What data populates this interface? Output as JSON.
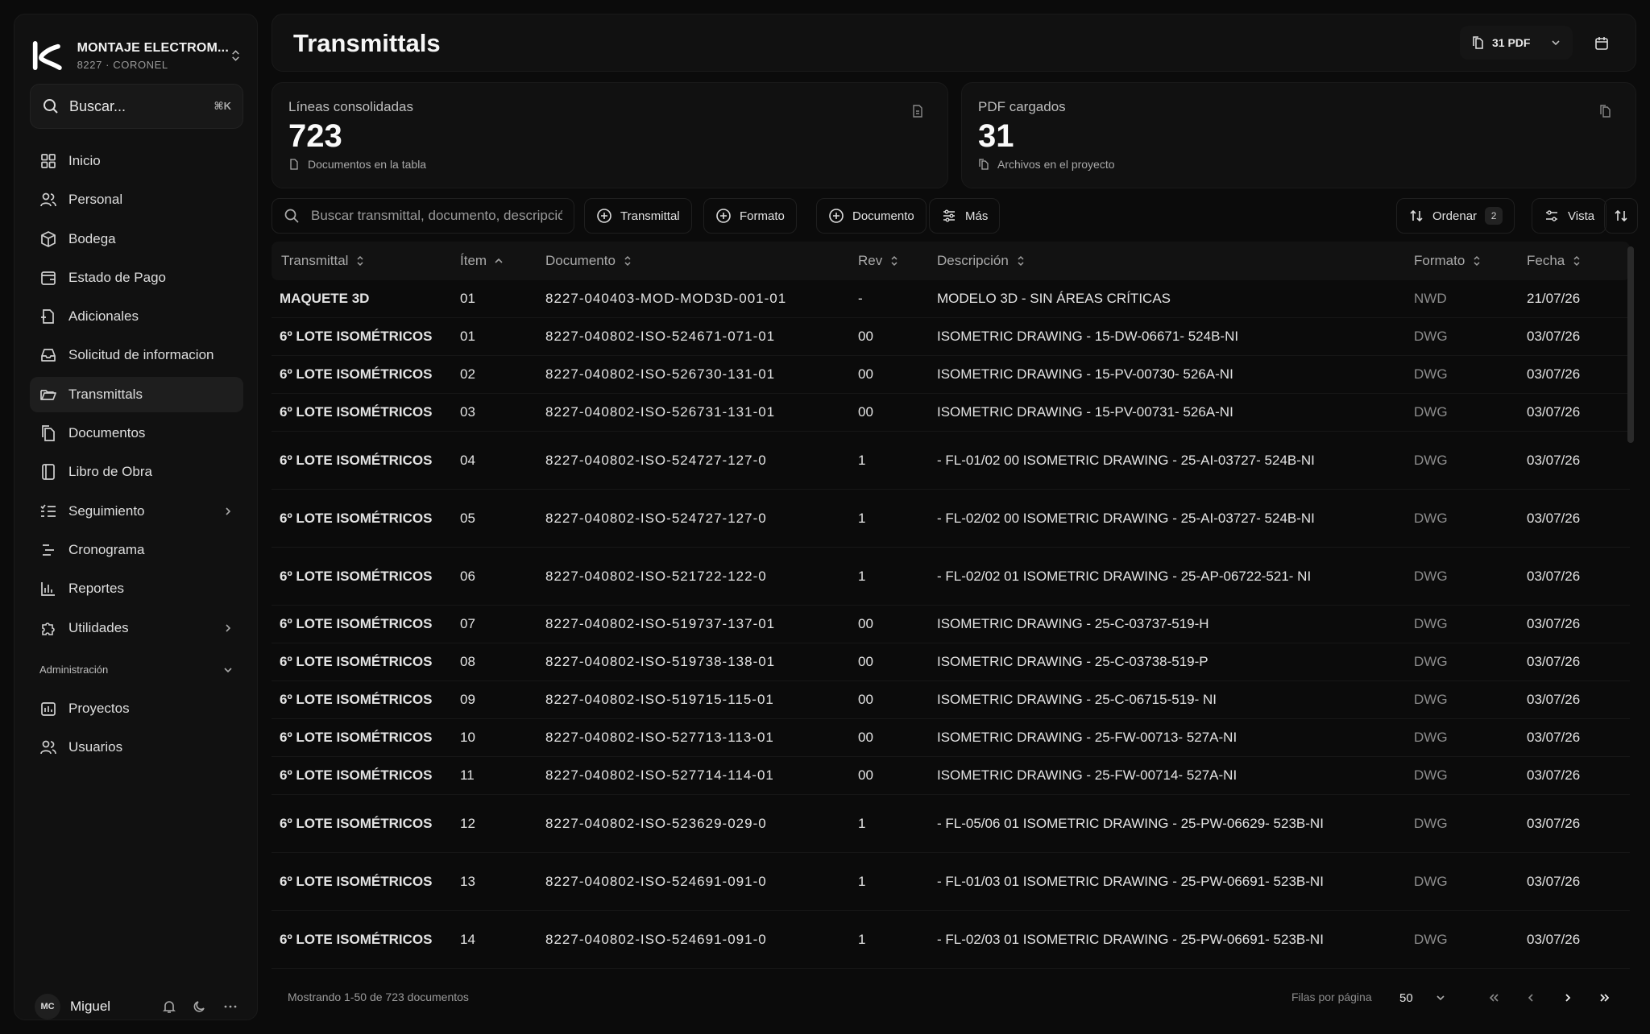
{
  "sidebar": {
    "company": "MONTAJE ELECTROM...",
    "company_sub": "8227 · CORONEL",
    "search_label": "Buscar...",
    "search_shortcut": "⌘K",
    "items": [
      {
        "label": "Inicio"
      },
      {
        "label": "Personal"
      },
      {
        "label": "Bodega"
      },
      {
        "label": "Estado de Pago"
      },
      {
        "label": "Adicionales"
      },
      {
        "label": "Solicitud de informacion"
      },
      {
        "label": "Transmittals"
      },
      {
        "label": "Documentos"
      },
      {
        "label": "Libro de Obra"
      },
      {
        "label": "Seguimiento"
      },
      {
        "label": "Cronograma"
      },
      {
        "label": "Reportes"
      },
      {
        "label": "Utilidades"
      }
    ],
    "section_label": "Administración",
    "admin_items": [
      {
        "label": "Proyectos"
      },
      {
        "label": "Usuarios"
      }
    ],
    "user": {
      "initials": "MC",
      "name": "Miguel"
    }
  },
  "header": {
    "title": "Transmittals",
    "pdf_button": "31 PDF"
  },
  "stats": [
    {
      "label": "Líneas consolidadas",
      "value": "723",
      "sub": "Documentos en la tabla"
    },
    {
      "label": "PDF cargados",
      "value": "31",
      "sub": "Archivos en el proyecto"
    }
  ],
  "toolbar": {
    "search_placeholder": "Buscar transmittal, documento, descripción...",
    "filters": [
      "Transmittal",
      "Formato",
      "Documento",
      "Más"
    ],
    "sort_label": "Ordenar",
    "sort_count": "2",
    "view_label": "Vista"
  },
  "table": {
    "columns": [
      "Transmittal",
      "Ítem",
      "Documento",
      "Rev",
      "Descripción",
      "Formato",
      "Fecha"
    ],
    "rows": [
      {
        "transmittal": "MAQUETE 3D",
        "item": "01",
        "documento": "8227-040403-MOD-MOD3D-001-01",
        "rev": "-",
        "descripcion": "MODELO 3D - SIN ÁREAS CRÍTICAS",
        "formato": "NWD",
        "fecha": "21/07/26"
      },
      {
        "transmittal": "6º LOTE ISOMÉTRICOS",
        "item": "01",
        "documento": "8227-040802-ISO-524671-071-01",
        "rev": "00",
        "descripcion": "ISOMETRIC DRAWING - 15-DW-06671- 524B-NI",
        "formato": "DWG",
        "fecha": "03/07/26"
      },
      {
        "transmittal": "6º LOTE ISOMÉTRICOS",
        "item": "02",
        "documento": "8227-040802-ISO-526730-131-01",
        "rev": "00",
        "descripcion": "ISOMETRIC DRAWING - 15-PV-00730- 526A-NI",
        "formato": "DWG",
        "fecha": "03/07/26"
      },
      {
        "transmittal": "6º LOTE ISOMÉTRICOS",
        "item": "03",
        "documento": "8227-040802-ISO-526731-131-01",
        "rev": "00",
        "descripcion": "ISOMETRIC DRAWING - 15-PV-00731- 526A-NI",
        "formato": "DWG",
        "fecha": "03/07/26"
      },
      {
        "transmittal": "6º LOTE ISOMÉTRICOS",
        "item": "04",
        "documento": "8227-040802-ISO-524727-127-0",
        "rev": "1",
        "descripcion": "- FL-01/02 00 ISOMETRIC DRAWING - 25-AI-03727- 524B-NI",
        "formato": "DWG",
        "fecha": "03/07/26"
      },
      {
        "transmittal": "6º LOTE ISOMÉTRICOS",
        "item": "05",
        "documento": "8227-040802-ISO-524727-127-0",
        "rev": "1",
        "descripcion": "- FL-02/02 00 ISOMETRIC DRAWING - 25-AI-03727- 524B-NI",
        "formato": "DWG",
        "fecha": "03/07/26"
      },
      {
        "transmittal": "6º LOTE ISOMÉTRICOS",
        "item": "06",
        "documento": "8227-040802-ISO-521722-122-0",
        "rev": "1",
        "descripcion": "- FL-02/02 01 ISOMETRIC DRAWING - 25-AP-06722-521- NI",
        "formato": "DWG",
        "fecha": "03/07/26"
      },
      {
        "transmittal": "6º LOTE ISOMÉTRICOS",
        "item": "07",
        "documento": "8227-040802-ISO-519737-137-01",
        "rev": "00",
        "descripcion": "ISOMETRIC DRAWING - 25-C-03737-519-H",
        "formato": "DWG",
        "fecha": "03/07/26"
      },
      {
        "transmittal": "6º LOTE ISOMÉTRICOS",
        "item": "08",
        "documento": "8227-040802-ISO-519738-138-01",
        "rev": "00",
        "descripcion": "ISOMETRIC DRAWING - 25-C-03738-519-P",
        "formato": "DWG",
        "fecha": "03/07/26"
      },
      {
        "transmittal": "6º LOTE ISOMÉTRICOS",
        "item": "09",
        "documento": "8227-040802-ISO-519715-115-01",
        "rev": "00",
        "descripcion": "ISOMETRIC DRAWING - 25-C-06715-519- NI",
        "formato": "DWG",
        "fecha": "03/07/26"
      },
      {
        "transmittal": "6º LOTE ISOMÉTRICOS",
        "item": "10",
        "documento": "8227-040802-ISO-527713-113-01",
        "rev": "00",
        "descripcion": "ISOMETRIC DRAWING - 25-FW-00713- 527A-NI",
        "formato": "DWG",
        "fecha": "03/07/26"
      },
      {
        "transmittal": "6º LOTE ISOMÉTRICOS",
        "item": "11",
        "documento": "8227-040802-ISO-527714-114-01",
        "rev": "00",
        "descripcion": "ISOMETRIC DRAWING - 25-FW-00714- 527A-NI",
        "formato": "DWG",
        "fecha": "03/07/26"
      },
      {
        "transmittal": "6º LOTE ISOMÉTRICOS",
        "item": "12",
        "documento": "8227-040802-ISO-523629-029-0",
        "rev": "1",
        "descripcion": "- FL-05/06 01 ISOMETRIC DRAWING - 25-PW-06629- 523B-NI",
        "formato": "DWG",
        "fecha": "03/07/26"
      },
      {
        "transmittal": "6º LOTE ISOMÉTRICOS",
        "item": "13",
        "documento": "8227-040802-ISO-524691-091-0",
        "rev": "1",
        "descripcion": "- FL-01/03 01 ISOMETRIC DRAWING - 25-PW-06691- 523B-NI",
        "formato": "DWG",
        "fecha": "03/07/26"
      },
      {
        "transmittal": "6º LOTE ISOMÉTRICOS",
        "item": "14",
        "documento": "8227-040802-ISO-524691-091-0",
        "rev": "1",
        "descripcion": "- FL-02/03 01 ISOMETRIC DRAWING - 25-PW-06691- 523B-NI",
        "formato": "DWG",
        "fecha": "03/07/26"
      }
    ]
  },
  "footer": {
    "showing": "Mostrando 1-50 de 723 documentos",
    "rows_per_page_label": "Filas por página",
    "rows_per_page": "50"
  }
}
